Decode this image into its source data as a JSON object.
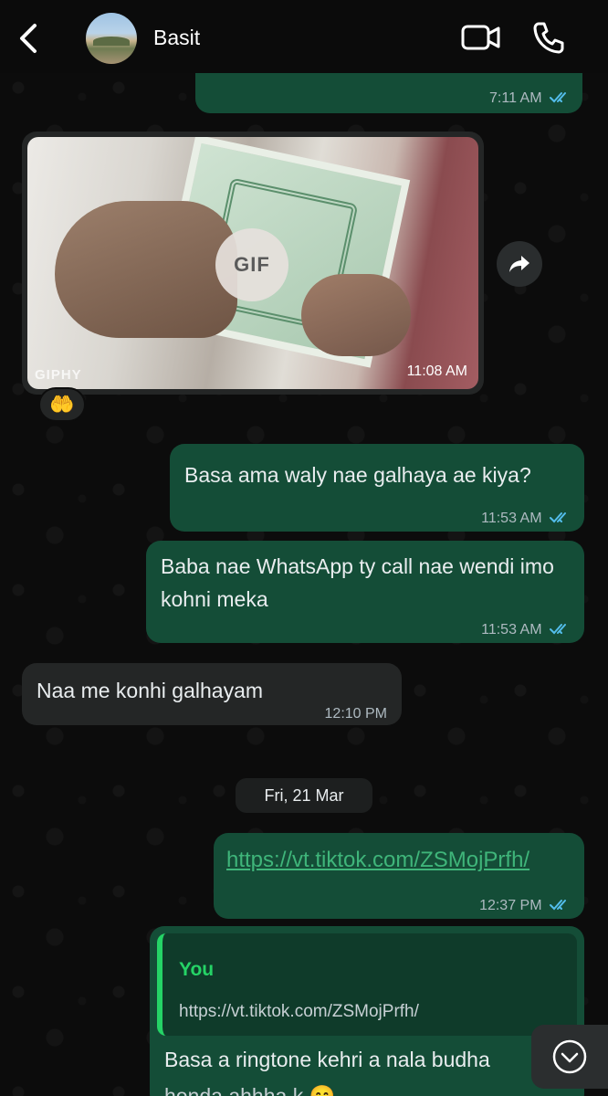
{
  "header": {
    "contact_name": "Basit"
  },
  "messages": {
    "top": {
      "time": "7:11 AM"
    },
    "gif": {
      "badge": "GIF",
      "source": "GIPHY",
      "time": "11:08 AM",
      "reaction": "🤲"
    },
    "m1": {
      "text": "Basa ama waly nae galhaya ae kiya?",
      "time": "11:53 AM"
    },
    "m2": {
      "text": "Baba nae WhatsApp ty call nae wendi imo kohni meka",
      "time": "11:53 AM"
    },
    "m3": {
      "text": "Naa me konhi galhayam",
      "time": "12:10 PM"
    },
    "date": "Fri, 21 Mar",
    "m4": {
      "text": "https://vt.tiktok.com/ZSMojPrfh/",
      "time": "12:37 PM"
    },
    "m5": {
      "quote_author": "You",
      "quote_text": "https://vt.tiktok.com/ZSMojPrfh/",
      "text": "Basa a ringtone kehri a nala budha",
      "text_partial": "honda ahhha k 😊"
    }
  },
  "colors": {
    "outgoing": "#144d37",
    "incoming": "#242626",
    "read_ticks": "#53bdeb",
    "accent": "#25d366"
  }
}
